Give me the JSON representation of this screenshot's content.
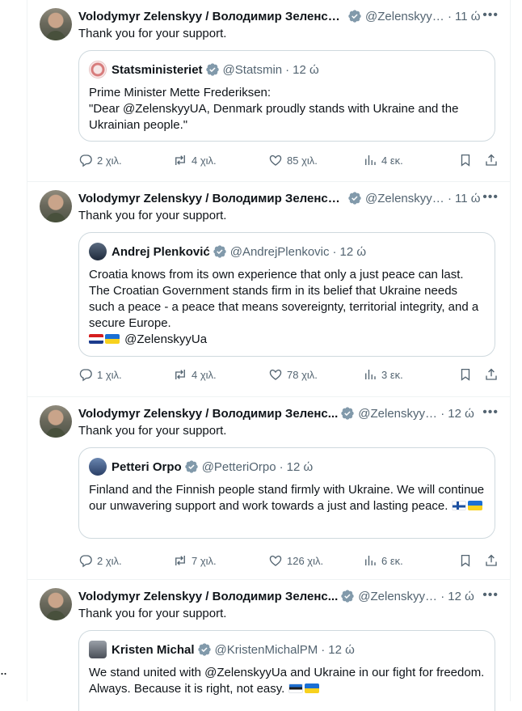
{
  "stray_dots": "..",
  "tweets": [
    {
      "author": "Volodymyr Zelenskyy / Володимир Зеленсь...",
      "handle": "@ZelenskyyUa",
      "time": "11 ώ",
      "text": "Thank you for your support.",
      "quote": {
        "name": "Statsministeriet",
        "handle": "@Statsmin",
        "time": "12 ώ",
        "lines": [
          "Prime Minister Mette Frederiksen:",
          "\"Dear @ZelenskyyUA, Denmark proudly stands with Ukraine and the Ukrainian people.\""
        ]
      },
      "stats": {
        "replies": "2 χιλ.",
        "reposts": "4 χιλ.",
        "likes": "85 χιλ.",
        "views": "4 εκ."
      }
    },
    {
      "author": "Volodymyr Zelenskyy / Володимир Зеленсь...",
      "handle": "@ZelenskyyUa",
      "time": "11 ώ",
      "text": "Thank you for your support.",
      "quote": {
        "name": "Andrej Plenković",
        "handle": "@AndrejPlenkovic",
        "time": "12 ώ",
        "lines": [
          "Croatia knows from its own experience that only a just peace can last. The Croatian Government stands firm in its belief that Ukraine needs such a peace - a peace that means sovereignty, territorial integrity, and a secure Europe."
        ],
        "mention": "@ZelenskyyUa"
      },
      "stats": {
        "replies": "1 χιλ.",
        "reposts": "4 χιλ.",
        "likes": "78 χιλ.",
        "views": "3 εκ."
      }
    },
    {
      "author": "Volodymyr Zelenskyy / Володимир Зеленс...",
      "handle": "@ZelenskyyUa",
      "time": "12 ώ",
      "text": "Thank you for your support.",
      "quote": {
        "name": "Petteri Orpo",
        "handle": "@PetteriOrpo",
        "time": "12 ώ",
        "lines": [
          "Finland and the Finnish people stand firmly with Ukraine. We will continue our unwavering support and work towards a just and lasting peace."
        ]
      },
      "stats": {
        "replies": "2 χιλ.",
        "reposts": "7 χιλ.",
        "likes": "126 χιλ.",
        "views": "6 εκ."
      }
    },
    {
      "author": "Volodymyr Zelenskyy / Володимир Зеленс...",
      "handle": "@ZelenskyyUa",
      "time": "12 ώ",
      "text": "Thank you for your support.",
      "quote": {
        "name": "Kristen Michal",
        "handle": "@KristenMichalPM",
        "time": "12 ώ",
        "lines": [
          "We stand united with @ZelenskyyUa and Ukraine in our fight for freedom. Always. Because it is right, not easy."
        ]
      }
    }
  ],
  "icons": {
    "verified": "verified-badge-icon",
    "more": "more-icon",
    "reply": "reply-icon",
    "repost": "repost-icon",
    "like": "like-icon",
    "views": "views-icon",
    "bookmark": "bookmark-icon",
    "share": "share-icon"
  },
  "colors": {
    "badge": "#829aab",
    "muted": "#536471",
    "border": "#cfd9de"
  }
}
